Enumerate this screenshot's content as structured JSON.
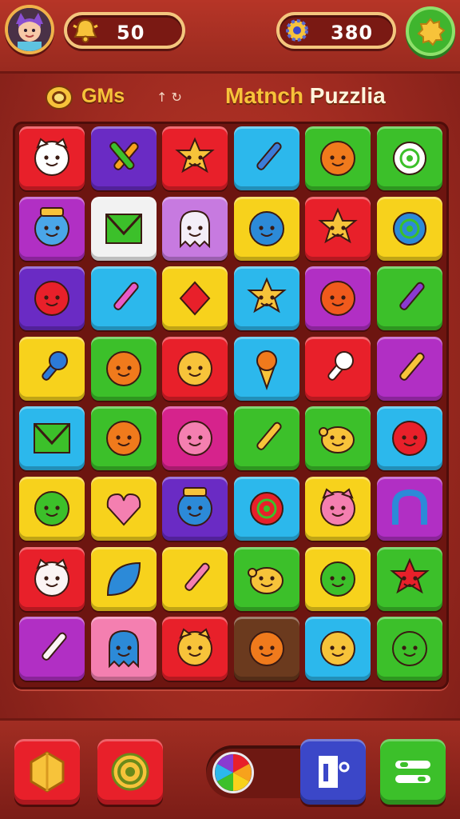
{
  "header": {
    "left_counter": {
      "value": "50",
      "icon": "bell-icon"
    },
    "right_counter": {
      "value": "380",
      "icon": "gear-coin-icon"
    },
    "avatar": "player-avatar",
    "menu_icon": "gear-icon"
  },
  "title": {
    "brand_icon": "smiley-badge-icon",
    "left_text": "GMs",
    "arrows": "↑ ↻",
    "main_word1": "Matnch",
    "main_word2": "Puzzlia"
  },
  "board": {
    "rows": 8,
    "cols": 6,
    "tiles": [
      {
        "color": "#e8202a",
        "icon": "cat-face-icon"
      },
      {
        "color": "#6a2bc4",
        "icon": "crossed-tools-icon"
      },
      {
        "color": "#e8202a",
        "icon": "sun-face-icon"
      },
      {
        "color": "#2cb8ec",
        "icon": "hammer-icon"
      },
      {
        "color": "#3cc02a",
        "icon": "orange-face-icon"
      },
      {
        "color": "#3cc02a",
        "icon": "candy-swirl-icon"
      },
      {
        "color": "#b12fc4",
        "icon": "hat-robot-icon"
      },
      {
        "color": "#f2f2f2",
        "icon": "flag-banner-icon"
      },
      {
        "color": "#c77ae0",
        "icon": "ghost-icon"
      },
      {
        "color": "#f7d21c",
        "icon": "blue-blob-icon"
      },
      {
        "color": "#e8202a",
        "icon": "star-face-icon"
      },
      {
        "color": "#f7d21c",
        "icon": "blue-flower-icon"
      },
      {
        "color": "#6a2bc4",
        "icon": "red-creature-icon"
      },
      {
        "color": "#2cb8ec",
        "icon": "brush-icon"
      },
      {
        "color": "#f7d21c",
        "icon": "red-gem-icon"
      },
      {
        "color": "#2cb8ec",
        "icon": "yellow-star-icon"
      },
      {
        "color": "#b12fc4",
        "icon": "bell-creature-icon"
      },
      {
        "color": "#3cc02a",
        "icon": "purple-bone-icon"
      },
      {
        "color": "#f7d21c",
        "icon": "spoon-icon"
      },
      {
        "color": "#3cc02a",
        "icon": "orange-star-icon"
      },
      {
        "color": "#e8202a",
        "icon": "yellow-face-icon"
      },
      {
        "color": "#2cb8ec",
        "icon": "ice-cream-icon"
      },
      {
        "color": "#e8202a",
        "icon": "magnifier-icon"
      },
      {
        "color": "#b12fc4",
        "icon": "pencil-icon"
      },
      {
        "color": "#2cb8ec",
        "icon": "fence-icon"
      },
      {
        "color": "#3cc02a",
        "icon": "orange-drop-icon"
      },
      {
        "color": "#d6238c",
        "icon": "pink-monster-icon"
      },
      {
        "color": "#3cc02a",
        "icon": "yellow-stick-icon"
      },
      {
        "color": "#3cc02a",
        "icon": "lemon-icon"
      },
      {
        "color": "#2cb8ec",
        "icon": "red-face-icon"
      },
      {
        "color": "#f7d21c",
        "icon": "green-frog-icon"
      },
      {
        "color": "#f7d21c",
        "icon": "pink-heart-icon"
      },
      {
        "color": "#6a2bc4",
        "icon": "blue-robot-icon"
      },
      {
        "color": "#2cb8ec",
        "icon": "red-flower-icon"
      },
      {
        "color": "#f7d21c",
        "icon": "pink-bear-icon"
      },
      {
        "color": "#b12fc4",
        "icon": "blue-arch-icon"
      },
      {
        "color": "#e8202a",
        "icon": "white-bear-icon"
      },
      {
        "color": "#f7d21c",
        "icon": "blue-leaf-icon"
      },
      {
        "color": "#f7d21c",
        "icon": "pink-crayon-icon"
      },
      {
        "color": "#3cc02a",
        "icon": "yellow-fish-icon"
      },
      {
        "color": "#f7d21c",
        "icon": "green-blob-icon"
      },
      {
        "color": "#3cc02a",
        "icon": "red-star-icon"
      },
      {
        "color": "#b12fc4",
        "icon": "white-bone-icon"
      },
      {
        "color": "#f47fb0",
        "icon": "blue-ghost-icon"
      },
      {
        "color": "#e8202a",
        "icon": "yellow-cat-icon"
      },
      {
        "color": "#6b3a1e",
        "icon": "orange-stick-icon"
      },
      {
        "color": "#2cb8ec",
        "icon": "yellow-blob-icon"
      },
      {
        "color": "#3cc02a",
        "icon": "green-swirl-icon"
      }
    ]
  },
  "footer": {
    "buttons": [
      {
        "name": "hexagon-button",
        "color": "#e8202a",
        "icon": "hexagon-icon"
      },
      {
        "name": "spiral-button",
        "color": "#e8202a",
        "icon": "spiral-icon"
      },
      {
        "name": "exit-button",
        "color": "#3b47c8",
        "icon": "door-icon"
      },
      {
        "name": "menu-button",
        "color": "#3cc02a",
        "icon": "menu-icon"
      }
    ],
    "wheel_icon": "color-wheel-icon"
  }
}
